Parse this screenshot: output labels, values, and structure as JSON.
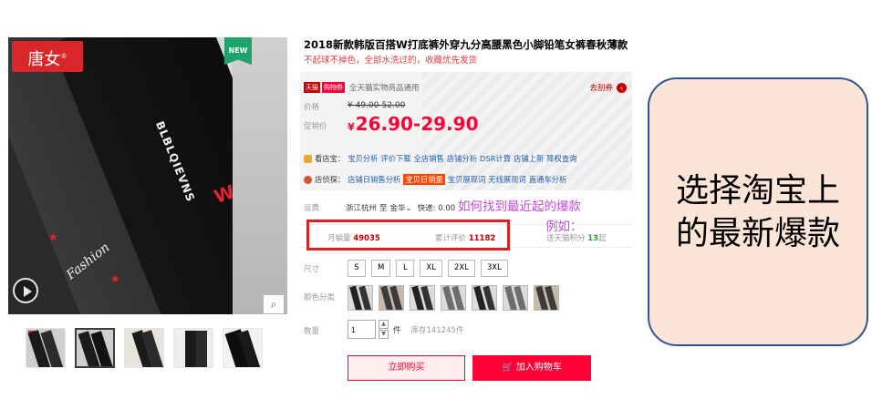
{
  "gallery": {
    "brand": "唐女",
    "brand_mark": "®",
    "badge": "NEW",
    "main_print": "BLBLQIEVNS",
    "main_mark": "W",
    "main_script": "Fashion",
    "thumbnail_count": 5,
    "active_thumbnail": 2
  },
  "product": {
    "title": "2018新款韩版百搭W打底裤外穿九分高腰黑色小脚铅笔女裤春秋薄款",
    "subtitle": "不起球不掉色，全部水洗过的，收藏优先发货"
  },
  "price_box": {
    "tmall_tag": "天猫",
    "coupon_tag": "购物券",
    "tmall_text": "全天猫实物商品通用",
    "coupon_link": "去刮券",
    "price_label": "价格",
    "original_price": "¥ 49.00-52.00",
    "promo_label": "促销价",
    "currency": "¥",
    "promo_price": "26.90-29.90",
    "row1": {
      "prefix": "看店宝：",
      "links": [
        "宝贝分析",
        "评价下载",
        "全店销售",
        "店铺分析",
        "DSR计算",
        "店铺上新",
        "降权查询"
      ]
    },
    "row2": {
      "prefix": "店侦探：",
      "links": [
        "店铺日销售分析",
        "宝贝日销量",
        "宝贝展现词",
        "无线展现词",
        "直通车分析"
      ],
      "highlight_index": 1
    }
  },
  "shipping": {
    "label": "运费",
    "from": "浙江杭州",
    "to_word": "至",
    "to": "金华",
    "fee": "快递: 0.00"
  },
  "annotation": {
    "line1": "如何找到最近起的爆款",
    "line2": "例如："
  },
  "stats": {
    "monthly_label": "月销量",
    "monthly_value": "49035",
    "reviews_label": "累计评价",
    "reviews_value": "11182",
    "points_label": "送天猫积分",
    "points_value": "13",
    "points_suffix": "起"
  },
  "options": {
    "size_label": "尺寸",
    "sizes": [
      "S",
      "M",
      "L",
      "XL",
      "2XL",
      "3XL"
    ],
    "color_label": "颜色分类",
    "color_count": 7,
    "qty_label": "数量",
    "qty_value": "1",
    "qty_unit": "件",
    "stock": "库存141245件"
  },
  "buttons": {
    "buy": "立即购买",
    "cart": "🛒 加入购物车"
  },
  "callout": {
    "line1": "选择淘宝上",
    "line2": "的最新爆款"
  },
  "colors": {
    "tmall_red": "#ff0036",
    "annotation_purple": "#c14bd5",
    "callout_fill": "#fbe5d6",
    "callout_border": "#2f5597",
    "highlight_box": "#e02020"
  }
}
